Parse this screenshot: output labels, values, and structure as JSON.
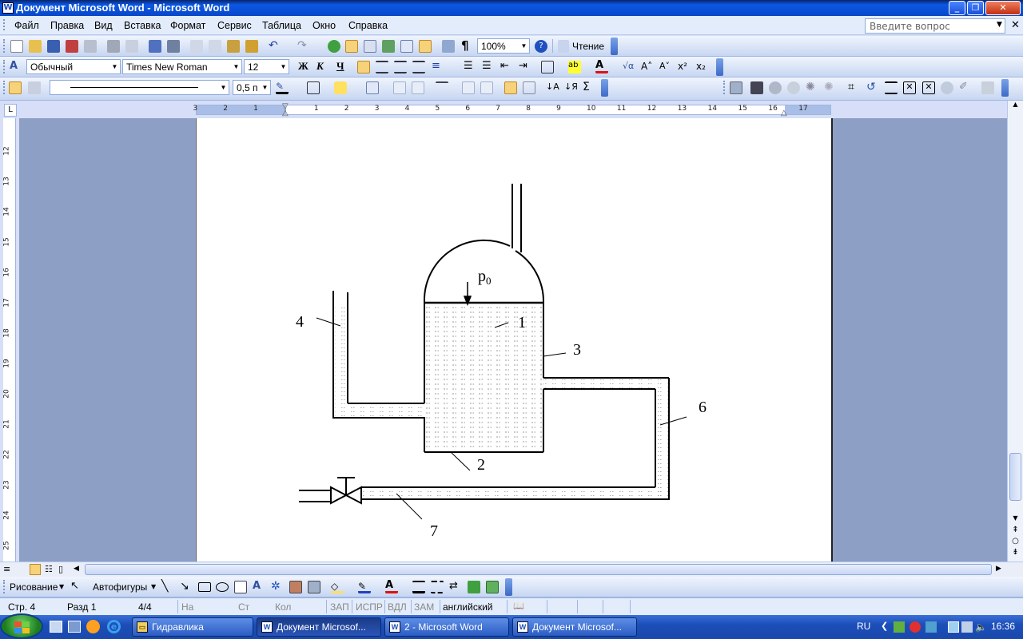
{
  "window": {
    "title": "Документ Microsoft Word - Microsoft Word",
    "icon": "word-icon"
  },
  "menu": [
    "Файл",
    "Правка",
    "Вид",
    "Вставка",
    "Формат",
    "Сервис",
    "Таблица",
    "Окно",
    "Справка"
  ],
  "ask_placeholder": "Введите вопрос",
  "standard_toolbar": {
    "zoom": "100%",
    "reading_label": "Чтение"
  },
  "formatting_toolbar": {
    "style": "Обычный",
    "font": "Times New Roman",
    "size": "12",
    "bold": "Ж",
    "italic": "К",
    "underline": "Ч"
  },
  "drawing_props_toolbar": {
    "line_weight": "0,5 п"
  },
  "ruler": {
    "horizontal": [
      "3",
      "2",
      "1",
      "1",
      "2",
      "3",
      "4",
      "5",
      "6",
      "7",
      "8",
      "9",
      "10",
      "11",
      "12",
      "13",
      "14",
      "15",
      "16",
      "17"
    ],
    "vertical": [
      "12",
      "13",
      "14",
      "15",
      "16",
      "17",
      "18",
      "19",
      "20",
      "21",
      "22",
      "23",
      "24",
      "25"
    ]
  },
  "figure": {
    "labels": {
      "p0": "p",
      "p0_sub": "0",
      "l1": "1",
      "l2": "2",
      "l3": "3",
      "l4": "4",
      "l6": "6",
      "l7": "7"
    }
  },
  "drawing_toolbar": {
    "draw_label": "Рисование",
    "autoshapes_label": "Автофигуры"
  },
  "status": {
    "page": "Стр. 4",
    "section": "Разд 1",
    "pages": "4/4",
    "at": "На",
    "line": "Ст",
    "col": "Кол",
    "rec": "ЗАП",
    "trk": "ИСПР",
    "ext": "ВДЛ",
    "ovr": "ЗАМ",
    "lang": "английский"
  },
  "taskbar": {
    "items": [
      "Гидравлика",
      "Документ Microsof...",
      "2 - Microsoft Word",
      "Документ Microsof..."
    ],
    "lang": "RU",
    "time": "16:36"
  }
}
